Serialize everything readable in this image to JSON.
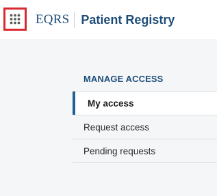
{
  "header": {
    "apps_icon": "grid-dots-icon",
    "brand_short": "EQRS",
    "brand_name": "Patient Registry",
    "accent_color": "#1f4e7a",
    "highlight_border_color": "#d9282e"
  },
  "nav": {
    "heading": "MANAGE ACCESS",
    "items": [
      {
        "label": "My access",
        "active": true
      },
      {
        "label": "Request access",
        "active": false
      },
      {
        "label": "Pending requests",
        "active": false
      }
    ]
  }
}
